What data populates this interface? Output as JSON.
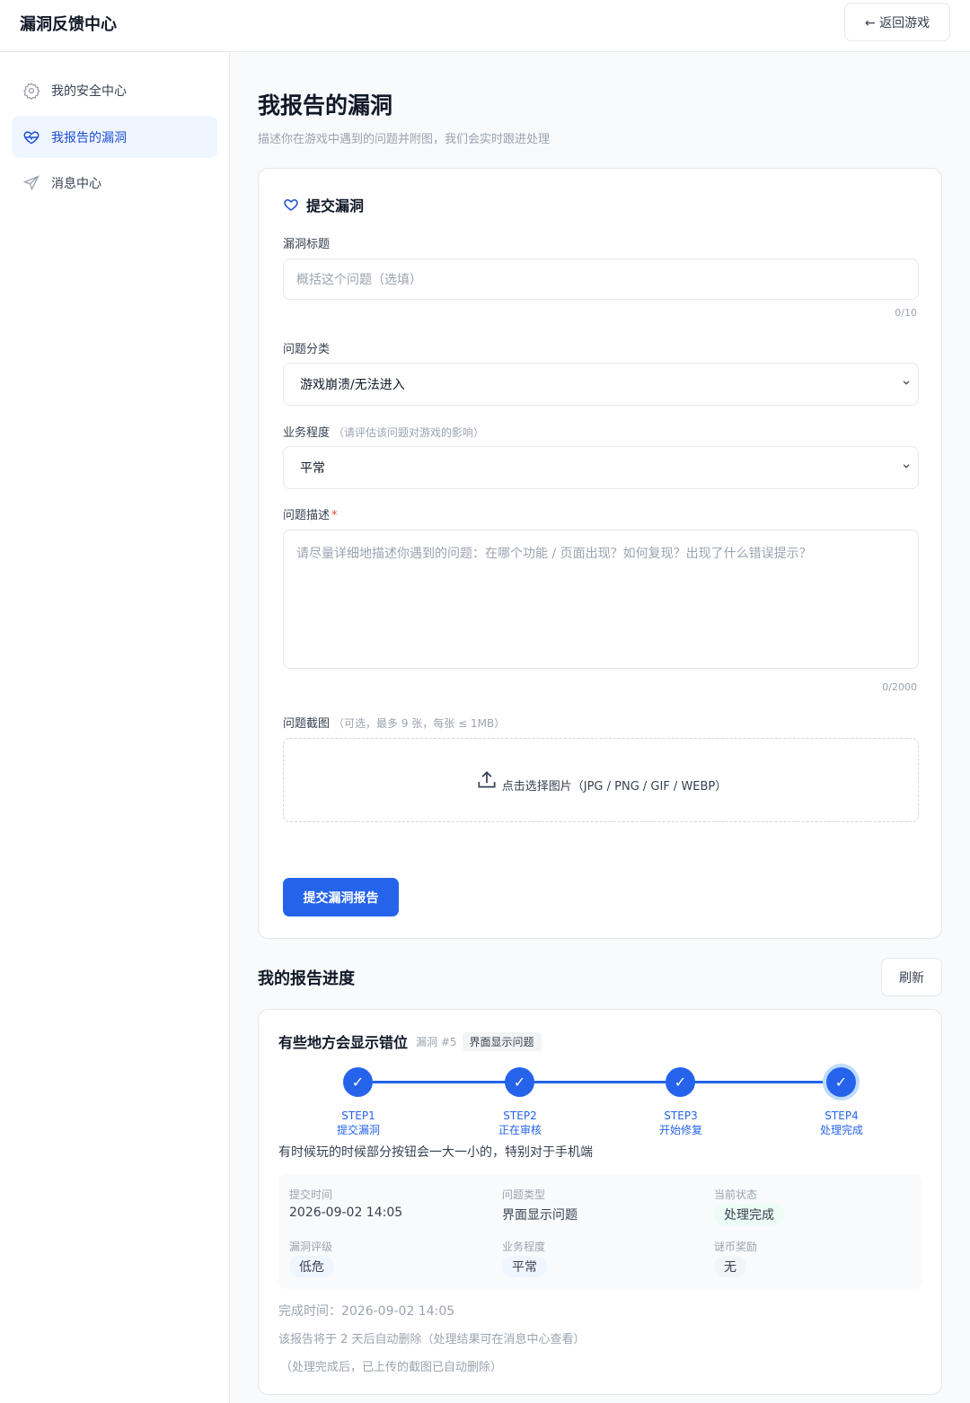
{
  "header": {
    "title": "漏洞反馈中心",
    "back_label": "← 返回游戏"
  },
  "sidebar": {
    "items": [
      {
        "label": "我的安全中心",
        "icon": "gear-icon",
        "active": false
      },
      {
        "label": "我报告的漏洞",
        "icon": "heart-icon",
        "active": true
      },
      {
        "label": "消息中心",
        "icon": "send-icon",
        "active": false
      }
    ]
  },
  "page": {
    "title": "我报告的漏洞",
    "subtitle": "描述你在游戏中遇到的问题并附图，我们会实时跟进处理"
  },
  "form": {
    "heading": "提交漏洞",
    "title_label": "漏洞标题",
    "title_placeholder": "概括这个问题（选填）",
    "title_counter": "0/10",
    "category_label": "问题分类",
    "category_value": "游戏崩溃/无法进入",
    "severity_label": "业务程度",
    "severity_hint": "（请评估该问题对游戏的影响）",
    "severity_value": "平常",
    "desc_label": "问题描述",
    "desc_required": "*",
    "desc_placeholder": "请尽量详细地描述你遇到的问题：在哪个功能 / 页面出现？如何复现？出现了什么错误提示？",
    "desc_counter": "0/2000",
    "screenshot_label": "问题截图",
    "screenshot_hint": "（可选，最多 9 张，每张 ≤ 1MB）",
    "upload_text": "点击选择图片（JPG / PNG / GIF / WEBP）",
    "submit_label": "提交漏洞报告"
  },
  "progress": {
    "section_title": "我的报告进度",
    "refresh_label": "刷新",
    "report": {
      "title": "有些地方会显示错位",
      "id": "漏洞 #5",
      "tag": "界面显示问题",
      "steps": [
        {
          "step": "STEP1",
          "label": "提交漏洞"
        },
        {
          "step": "STEP2",
          "label": "正在审核"
        },
        {
          "step": "STEP3",
          "label": "开始修复"
        },
        {
          "step": "STEP4",
          "label": "处理完成"
        }
      ],
      "check": "✓",
      "description": "有时候玩的时候部分按钮会一大一小的，特别对于手机端",
      "info": {
        "submit_time_label": "提交时间",
        "submit_time": "2026-09-02 14:05",
        "type_label": "问题类型",
        "type": "界面显示问题",
        "status_label": "当前状态",
        "status": "处理完成",
        "rating_label": "漏洞评级",
        "rating": "低危",
        "severity_label": "业务程度",
        "severity": "平常",
        "reward_label": "谜币奖励",
        "reward": "无"
      },
      "finish_time": "完成时间：2026-09-02 14:05",
      "delete_note": "该报告将于 2 天后自动删除（处理结果可在消息中心查看）",
      "screenshot_note": "（处理完成后，已上传的截图已自动删除）"
    }
  },
  "colors": {
    "accent": "#2563eb",
    "active_bg": "#eff6ff",
    "required": "#ef4444"
  }
}
